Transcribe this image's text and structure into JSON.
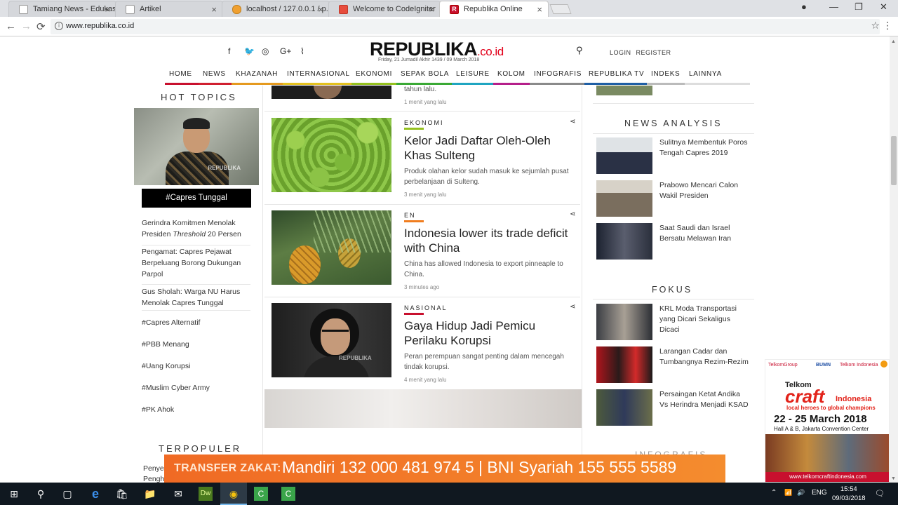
{
  "browser": {
    "tabs": [
      {
        "title": "Tamiang News - Edukasi",
        "close": "×"
      },
      {
        "title": "Artikel",
        "close": "×"
      },
      {
        "title": "localhost / 127.0.0.1 / p...",
        "close": "×"
      },
      {
        "title": "Welcome to CodeIgniter",
        "close": "×"
      },
      {
        "title": "Republika Online",
        "close": "×"
      }
    ],
    "url": "www.republika.co.id",
    "window_controls": {
      "minimize": "—",
      "maximize": "❐",
      "close": "✕"
    },
    "nav": {
      "back": "←",
      "forward": "→",
      "reload": "⟳",
      "star": "☆",
      "menu": "⋮",
      "info": "i"
    }
  },
  "site": {
    "logo_main": "REPUBLIKA",
    "logo_suffix": ".co.id",
    "dateline": "Friday, 21 Jumadil Akhir 1439 / 09 March 2018",
    "social_icons": [
      "facebook-icon",
      "twitter-icon",
      "instagram-icon",
      "google-plus-icon",
      "rss-icon"
    ],
    "social_glyphs": [
      "f",
      "🐦",
      "◎",
      "G+",
      "⌇"
    ],
    "search_glyph": "⚲",
    "login": "LOGIN",
    "register": "REGISTER",
    "nav": [
      {
        "label": "HOME",
        "color": "#c8102e"
      },
      {
        "label": "NEWS",
        "color": "#d01f2f"
      },
      {
        "label": "KHAZANAH",
        "color": "#e59a1f"
      },
      {
        "label": "INTERNASIONAL",
        "color": "#e3c11f"
      },
      {
        "label": "EKONOMI",
        "color": "#95c11f"
      },
      {
        "label": "SEPAK BOLA",
        "color": "#3aa935"
      },
      {
        "label": "LEISURE",
        "color": "#1fa5c1"
      },
      {
        "label": "KOLOM",
        "color": "#b51f8a"
      },
      {
        "label": "INFOGRAFIS",
        "color": "#8a8a8a"
      },
      {
        "label": "REPUBLIKA TV",
        "color": "#1f5fa5"
      },
      {
        "label": "INDEKS",
        "color": "#bbbbbb"
      },
      {
        "label": "LAINNYA",
        "color": "#dddddd"
      }
    ]
  },
  "left": {
    "hot_title": "HOT TOPICS",
    "hot_image_watermark": "REPUBLIKA",
    "hot_caption": "#Capres Tunggal",
    "links": [
      {
        "a": "Gerindra Komitmen Menolak Presiden ",
        "em": "Threshold",
        "b": " 20 Persen"
      },
      {
        "a": "Pengamat: Capres Pejawat Berpeluang Borong Dukungan Parpol"
      },
      {
        "a": "Gus Sholah: Warga NU Harus Menolak Capres Tunggal"
      }
    ],
    "tags": [
      "#Capres Alternatif",
      "#PBB Menang",
      "#Uang Korupsi",
      "#Muslim Cyber Army",
      "#PK Ahok"
    ],
    "terpopuler": "TERPOPULER",
    "terpop_partial": [
      "Penye",
      "Pengh"
    ]
  },
  "articles": {
    "top_partial": {
      "snippet": "tahun lalu.",
      "time": "1 menit yang lalu"
    },
    "items": [
      {
        "category": "EKONOMI",
        "color": "#95c11f",
        "title": "Kelor Jadi Daftar Oleh-Oleh Khas Sulteng",
        "desc": "Produk olahan kelor sudah masuk ke sejumlah pusat perbelanjaan di Sulteng.",
        "time": "3 menit yang lalu",
        "image": "moringa-leaves"
      },
      {
        "category": "EN",
        "color": "#f07d1f",
        "title": "Indonesia lower its trade deficit with China",
        "desc": "China has allowed Indonesia to export pinneaple to China.",
        "time": "3 minutes ago",
        "image": "pineapple"
      },
      {
        "category": "NASIONAL",
        "color": "#c8102e",
        "title": "Gaya Hidup Jadi Pemicu Perilaku Korupsi",
        "desc": "Peran perempuan sangat penting dalam mencegah tindak korupsi.",
        "time": "4 menit yang lalu",
        "image": "woman-portrait"
      }
    ],
    "share_glyph": "⋖",
    "watermark": "REPUBLIKA"
  },
  "right": {
    "news_analysis_title": "NEWS ANALYSIS",
    "news_analysis": [
      "Sulitnya Membentuk Poros Tengah Capres 2019",
      "Prabowo Mencari Calon Wakil Presiden",
      "Saat Saudi dan Israel Bersatu Melawan Iran"
    ],
    "fokus_title": "FOKUS",
    "fokus": [
      "KRL Moda Transportasi yang Dicari Sekaligus Dicaci",
      "Larangan Cadar dan Tumbangnya Rezim-Rezim",
      "Persaingan Ketat Andika Vs Herindra Menjadi KSAD"
    ],
    "infografis_title": "INFOGRAFIS"
  },
  "ad": {
    "logos": [
      "TelkomGroup",
      "BUMN",
      "Telkom Indonesia"
    ],
    "brand": "Telkom",
    "craft": "craft",
    "indonesia": "Indonesia",
    "tagline": "local heroes to global champions",
    "dates": "22 - 25 March 2018",
    "venue": "Hall A & B, Jakarta Convention Center",
    "url": "www.telkomcraftindonesia.com"
  },
  "banner": {
    "label": "TRANSFER ZAKAT:",
    "text": "Mandiri 132 000 481 974 5 | BNI Syariah 155 555 5589"
  },
  "taskbar": {
    "time": "15:54",
    "date": "09/03/2018",
    "lang": "ENG",
    "apps": [
      {
        "name": "start-icon",
        "glyph": "⊞"
      },
      {
        "name": "search-icon",
        "glyph": "⚲"
      },
      {
        "name": "task-view-icon",
        "glyph": "▢"
      },
      {
        "name": "edge-icon",
        "glyph": "e"
      },
      {
        "name": "store-icon",
        "glyph": "🛍"
      },
      {
        "name": "file-explorer-icon",
        "glyph": "📁"
      },
      {
        "name": "mail-icon",
        "glyph": "✉"
      },
      {
        "name": "dreamweaver-icon",
        "glyph": "Dw"
      },
      {
        "name": "chrome-icon",
        "glyph": "◉"
      },
      {
        "name": "camtasia-icon",
        "glyph": "C"
      },
      {
        "name": "camtasia-recorder-icon",
        "glyph": "C"
      }
    ],
    "tray": {
      "chevron": "⌃",
      "network": "📶",
      "volume": "🔊",
      "notification": "🗨"
    }
  }
}
